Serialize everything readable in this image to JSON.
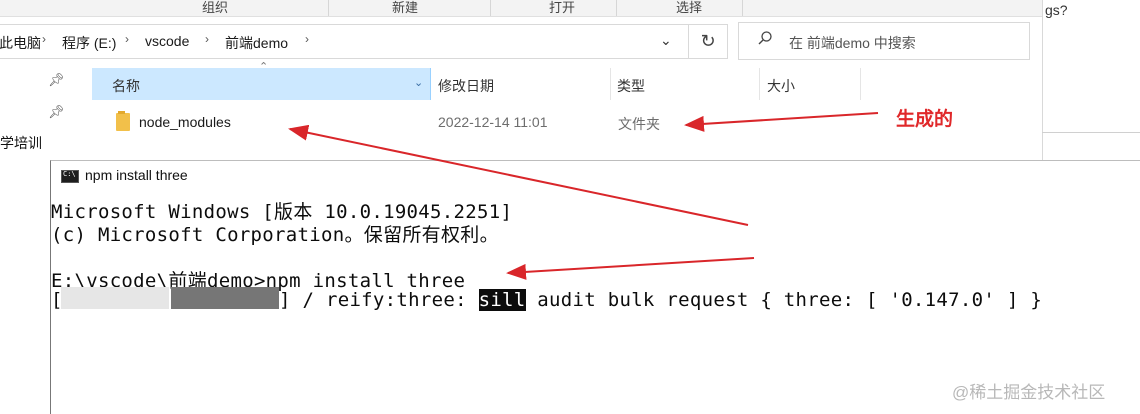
{
  "ribbon": {
    "items": [
      "组织",
      "新建",
      "打开",
      "选择"
    ]
  },
  "address": {
    "crumbs": [
      "此电脑",
      "程序 (E:)",
      "vscode",
      "前端demo"
    ]
  },
  "search": {
    "placeholder": "在 前端demo 中搜索"
  },
  "sidebar": {
    "label": "学培训"
  },
  "columns": {
    "name": "名称",
    "modified": "修改日期",
    "type": "类型",
    "size": "大小"
  },
  "files": [
    {
      "name": "node_modules",
      "modified": "2022-12-14 11:01",
      "type": "文件夹"
    }
  ],
  "annotation": {
    "text": "生成的",
    "color": "#e0282a"
  },
  "edge_text": "gs?",
  "terminal": {
    "title": "npm install three",
    "lines": [
      "Microsoft Windows [版本 10.0.19045.2251]",
      "(c) Microsoft Corporation。保留所有权利。",
      "",
      "E:\\vscode\\前端demo>npm install three"
    ],
    "progress": {
      "open": "[",
      "close": "]",
      "status_before": " / reify:three: ",
      "highlight": "sill",
      "status_after": " audit bulk request { three: [ '0.147.0' ] }"
    }
  },
  "watermark": "@稀土掘金技术社区",
  "colors": {
    "selected_header": "#cce8ff",
    "arrow": "#d9262a"
  }
}
